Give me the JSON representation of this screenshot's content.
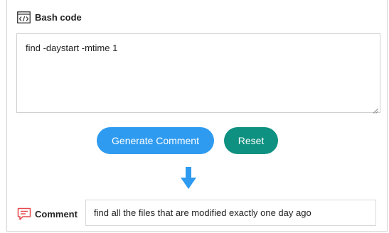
{
  "header": {
    "title": "Bash code",
    "icon": "code-icon"
  },
  "code": {
    "value": "find -daystart -mtime 1"
  },
  "buttons": {
    "generate_label": "Generate Comment",
    "generate_color": "#2f9bf0",
    "reset_label": "Reset",
    "reset_color": "#0e9180"
  },
  "arrow": {
    "icon": "arrow-down-icon",
    "color": "#2f9bf0"
  },
  "comment": {
    "label": "Comment",
    "icon": "comment-icon",
    "icon_color": "#e5484d",
    "value": "find all the files that are modified exactly one day ago"
  }
}
